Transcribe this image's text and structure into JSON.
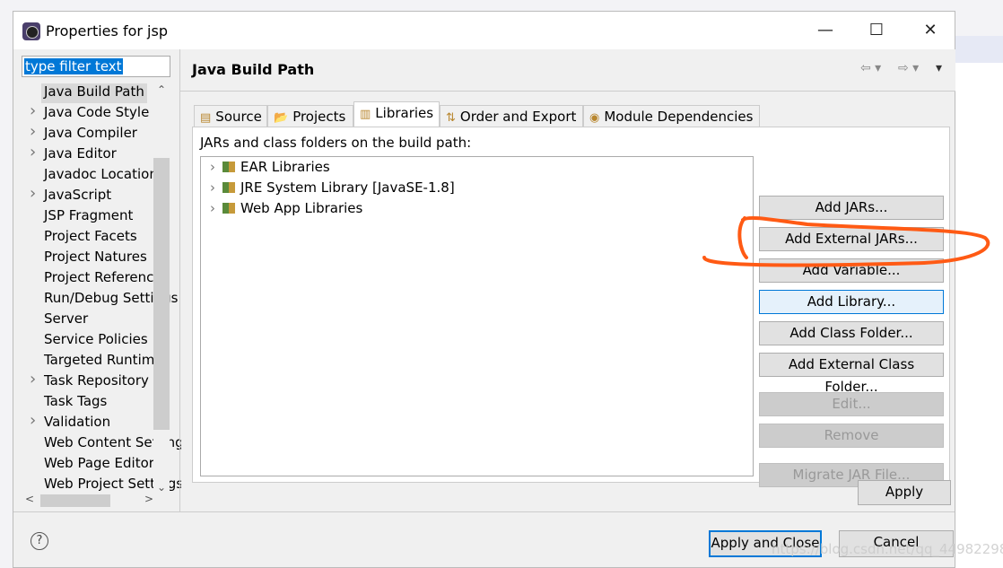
{
  "window": {
    "title": "Properties for jsp",
    "minimize": "—",
    "maximize": "☐",
    "close": "✕"
  },
  "filter": {
    "value": "type filter text"
  },
  "tree": {
    "items": [
      {
        "label": "Java Build Path",
        "expandable": false,
        "selected": true
      },
      {
        "label": "Java Code Style",
        "expandable": true
      },
      {
        "label": "Java Compiler",
        "expandable": true
      },
      {
        "label": "Java Editor",
        "expandable": true
      },
      {
        "label": "Javadoc Location",
        "expandable": false
      },
      {
        "label": "JavaScript",
        "expandable": true
      },
      {
        "label": "JSP Fragment",
        "expandable": false
      },
      {
        "label": "Project Facets",
        "expandable": false
      },
      {
        "label": "Project Natures",
        "expandable": false
      },
      {
        "label": "Project References",
        "expandable": false
      },
      {
        "label": "Run/Debug Settings",
        "expandable": false
      },
      {
        "label": "Server",
        "expandable": false
      },
      {
        "label": "Service Policies",
        "expandable": false
      },
      {
        "label": "Targeted Runtimes",
        "expandable": false
      },
      {
        "label": "Task Repository",
        "expandable": true
      },
      {
        "label": "Task Tags",
        "expandable": false
      },
      {
        "label": "Validation",
        "expandable": true
      },
      {
        "label": "Web Content Settings",
        "expandable": false
      },
      {
        "label": "Web Page Editor",
        "expandable": false
      },
      {
        "label": "Web Project Settings",
        "expandable": false
      }
    ]
  },
  "page": {
    "title": "Java Build Path"
  },
  "tabs": [
    {
      "label": "Source",
      "icon": "source-folder-icon"
    },
    {
      "label": "Projects",
      "icon": "folder-icon"
    },
    {
      "label": "Libraries",
      "icon": "library-icon",
      "active": true
    },
    {
      "label": "Order and Export",
      "icon": "order-icon"
    },
    {
      "label": "Module Dependencies",
      "icon": "module-icon"
    }
  ],
  "libraries": {
    "label": "JARs and class folders on the build path:",
    "items": [
      "EAR Libraries",
      "JRE System Library [JavaSE-1.8]",
      "Web App Libraries"
    ]
  },
  "buttons": [
    {
      "label": "Add JARs...",
      "enabled": true
    },
    {
      "label": "Add External JARs...",
      "enabled": true
    },
    {
      "label": "Add Variable...",
      "enabled": true
    },
    {
      "label": "Add Library...",
      "enabled": true,
      "highlighted": true
    },
    {
      "label": "Add Class Folder...",
      "enabled": true
    },
    {
      "label": "Add External Class Folder...",
      "enabled": true
    },
    {
      "label": "Edit...",
      "enabled": false
    },
    {
      "label": "Remove",
      "enabled": false
    },
    {
      "label": "Migrate JAR File...",
      "enabled": false
    }
  ],
  "apply": "Apply",
  "help": "?",
  "footer": {
    "apply_close": "Apply and Close",
    "cancel": "Cancel"
  },
  "watermark": "https://blog.csdn.net/qq_44982298",
  "colors": {
    "accent": "#0078d7",
    "annotation": "#ff5a14"
  }
}
